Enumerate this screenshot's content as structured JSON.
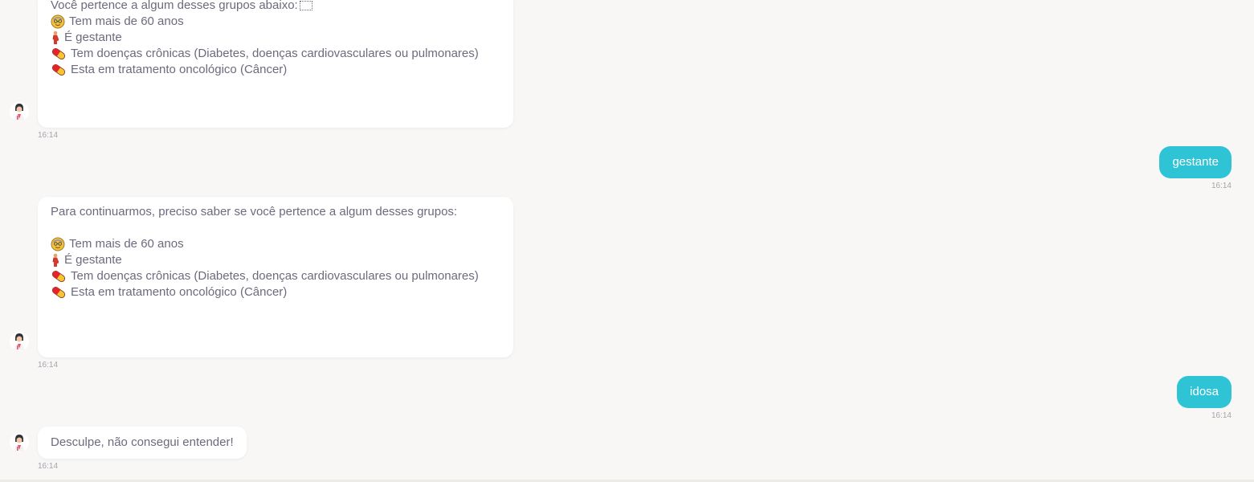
{
  "messages": {
    "bot1": {
      "partial_header": "Você pertence a algum desses grupos abaixo:",
      "items": [
        {
          "icon": "older-person-icon",
          "text": "Tem mais de 60 anos"
        },
        {
          "icon": "pregnant-woman-icon",
          "text": "É gestante"
        },
        {
          "icon": "pill-icon",
          "text": "Tem doenças crônicas (Diabetes, doenças cardiovasculares ou pulmonares)"
        },
        {
          "icon": "pill-icon",
          "text": "Esta em tratamento oncológico (Câncer)"
        }
      ],
      "time": "16:14"
    },
    "user1": {
      "text": "gestante",
      "time": "16:14"
    },
    "bot2": {
      "header": "Para continuarmos, preciso saber se você pertence a algum desses grupos:",
      "items": [
        {
          "icon": "older-person-icon",
          "text": "Tem mais de 60 anos"
        },
        {
          "icon": "pregnant-woman-icon",
          "text": "É gestante"
        },
        {
          "icon": "pill-icon",
          "text": "Tem doenças crônicas (Diabetes, doenças cardiovasculares ou pulmonares)"
        },
        {
          "icon": "pill-icon",
          "text": "Esta em tratamento oncológico (Câncer)"
        }
      ],
      "time": "16:14"
    },
    "user2": {
      "text": "idosa",
      "time": "16:14"
    },
    "bot3": {
      "text": "Desculpe, não consegui entender!",
      "time": "16:14"
    }
  },
  "colors": {
    "background": "#f8f7f5",
    "user_bubble": "#2ec4d6",
    "bot_text": "#6b6b7d",
    "timestamp": "#a4a4ae"
  }
}
